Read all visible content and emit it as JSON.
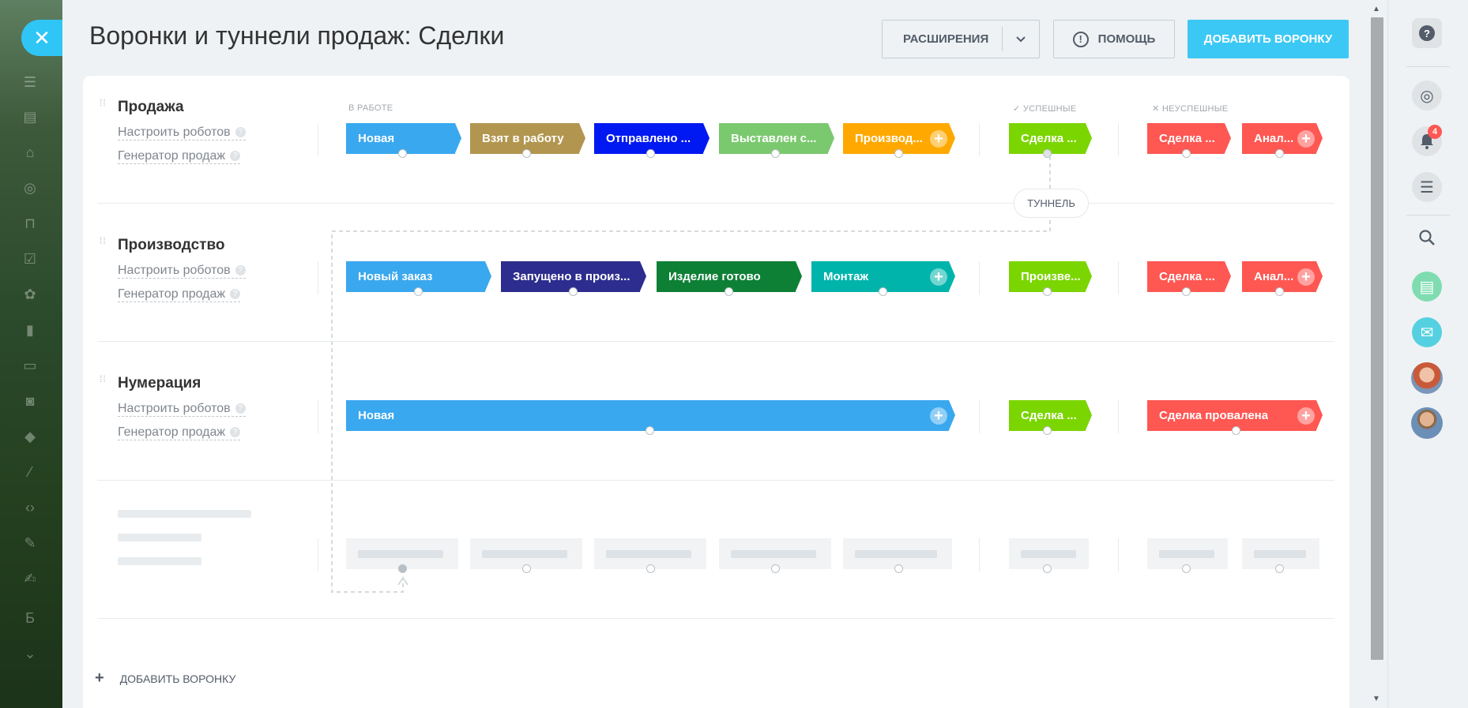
{
  "page": {
    "title": "Воронки и туннели продаж: Сделки",
    "extensions_label": "РАСШИРЕНИЯ",
    "help_label": "ПОМОЩЬ",
    "add_funnel_top_label": "ДОБАВИТЬ ВОРОНКУ",
    "add_funnel_bottom_label": "ДОБАВИТЬ ВОРОНКУ"
  },
  "columns": {
    "in_work": "В РАБОТЕ",
    "success": "УСПЕШНЫЕ",
    "fail": "НЕУСПЕШНЫЕ"
  },
  "tunnel_label": "ТУННЕЛЬ",
  "notifications_count": "4",
  "funnels": [
    {
      "name": "Продажа",
      "robots_link": "Настроить роботов",
      "generator_link": "Генератор продаж",
      "stages": [
        {
          "label": "Новая",
          "color": "#39a8ef"
        },
        {
          "label": "Взят в работу",
          "color": "#b2964f"
        },
        {
          "label": "Отправлено ...",
          "color": "#0018f2"
        },
        {
          "label": "Выставлен с...",
          "color": "#7bc96f"
        },
        {
          "label": "Производ...",
          "color": "#ffa900"
        }
      ],
      "success": [
        {
          "label": "Сделка ...",
          "color": "#7bd500"
        }
      ],
      "fail": [
        {
          "label": "Сделка ...",
          "color": "#ff5752"
        },
        {
          "label": "Анал...",
          "color": "#ff5752"
        }
      ]
    },
    {
      "name": "Производство",
      "robots_link": "Настроить роботов",
      "generator_link": "Генератор продаж",
      "stages": [
        {
          "label": "Новый заказ",
          "color": "#39a8ef"
        },
        {
          "label": "Запущено в произ...",
          "color": "#2d2d8f"
        },
        {
          "label": "Изделие готово",
          "color": "#0e8036"
        },
        {
          "label": "Монтаж",
          "color": "#00b4ac"
        }
      ],
      "success": [
        {
          "label": "Произве...",
          "color": "#7bd500"
        }
      ],
      "fail": [
        {
          "label": "Сделка ...",
          "color": "#ff5752"
        },
        {
          "label": "Анал...",
          "color": "#ff5752"
        }
      ]
    },
    {
      "name": "Нумерация",
      "robots_link": "Настроить роботов",
      "generator_link": "Генератор продаж",
      "stages": [
        {
          "label": "Новая",
          "color": "#39a8ef"
        }
      ],
      "success": [
        {
          "label": "Сделка ...",
          "color": "#7bd500"
        }
      ],
      "fail": [
        {
          "label": "Сделка провалена",
          "color": "#ff5752"
        }
      ]
    }
  ],
  "icons": {
    "close": "close-icon",
    "help": "question-icon",
    "notifications": "bell-icon",
    "search": "search-icon"
  }
}
